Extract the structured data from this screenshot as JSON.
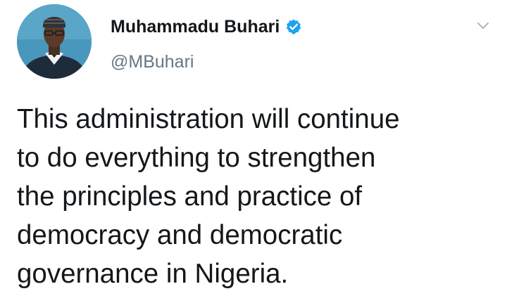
{
  "tweet": {
    "author": {
      "display_name": "Muhammadu Buhari",
      "handle": "@MBuhari",
      "verified": true,
      "avatar_icon": "profile-photo"
    },
    "menu_icon": "chevron-down-icon",
    "text": "This administration will continue\nto do everything to strengthen\nthe principles and practice of\ndemocracy and democratic\ngovernance in Nigeria."
  },
  "colors": {
    "verified_blue": "#1da1f2",
    "handle_gray": "#657786",
    "caret_gray": "#aab8c2",
    "text_dark": "#14171a"
  }
}
